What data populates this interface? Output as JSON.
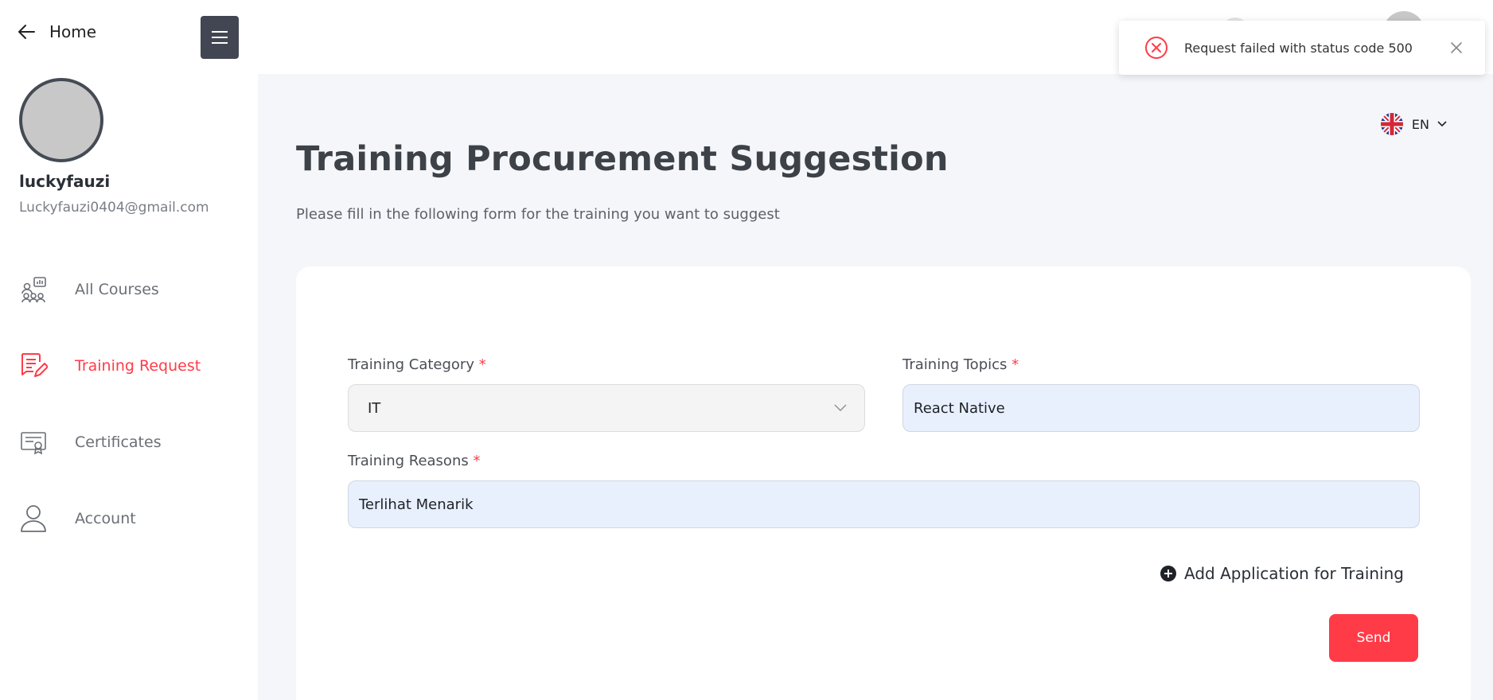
{
  "sidebar": {
    "home_label": "Home",
    "user": {
      "name": "luckyfauzi",
      "email": "Luckyfauzi0404@gmail.com"
    },
    "items": [
      {
        "label": "All Courses",
        "icon": "courses-icon"
      },
      {
        "label": "Training Request",
        "icon": "training-request-icon",
        "active": true
      },
      {
        "label": "Certificates",
        "icon": "certificate-icon"
      },
      {
        "label": "Account",
        "icon": "account-icon"
      }
    ]
  },
  "header": {
    "language": "EN"
  },
  "page": {
    "title": "Training Procurement Suggestion",
    "subtitle": "Please fill in the following form for the training you want to suggest"
  },
  "form": {
    "category": {
      "label": "Training Category",
      "required_mark": "*",
      "value": "IT"
    },
    "topics": {
      "label": "Training Topics",
      "required_mark": "*",
      "value": "React Native"
    },
    "reasons": {
      "label": "Training Reasons",
      "required_mark": "*",
      "value": "Terlihat Menarik"
    },
    "add_link": "Add Application for Training",
    "send_label": "Send"
  },
  "toast": {
    "message": "Request failed with status code 500"
  },
  "colors": {
    "accent": "#ff3b48",
    "sidebar_button": "#414652",
    "main_bg": "#f5f6fa",
    "input_fill": "#e8f0fe"
  }
}
